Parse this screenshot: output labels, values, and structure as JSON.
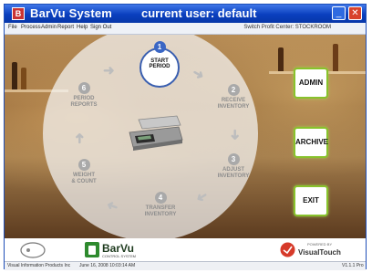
{
  "window": {
    "app_title": "BarVu System",
    "user_title": "current user: default"
  },
  "menu": {
    "items": [
      "File",
      "Process",
      "Admin",
      "Report",
      "Help",
      "Sign Out"
    ],
    "profit_center": "Switch Profit Center:  STOCKROOM"
  },
  "steps": [
    {
      "num": "1",
      "line1": "START",
      "line2": "PERIOD"
    },
    {
      "num": "2",
      "line1": "RECEIVE",
      "line2": "INVENTORY"
    },
    {
      "num": "3",
      "line1": "ADJUST",
      "line2": "INVENTORY"
    },
    {
      "num": "4",
      "line1": "TRANSFER",
      "line2": "INVENTORY"
    },
    {
      "num": "5",
      "line1": "WEIGHT",
      "line2": "& COUNT"
    },
    {
      "num": "6",
      "line1": "PERIOD",
      "line2": "REPORTS"
    }
  ],
  "buttons": {
    "admin": "ADMIN",
    "archive": "ARCHIVE",
    "exit": "EXIT"
  },
  "footer": {
    "brand": "BarVu",
    "brand_sub": "CONTROL SYSTEM",
    "powered_by": "POWERED BY",
    "visual_touch": "VisualTouch"
  },
  "status": {
    "company": "Visual Information Products Inc",
    "datetime": "June 16, 2008 10:03:14 AM",
    "version": "V1.1.1 Pro"
  },
  "colors": {
    "title_bar": "#0a3fbe",
    "accent_green": "#88c22c",
    "step_blue": "#3a66c4"
  }
}
